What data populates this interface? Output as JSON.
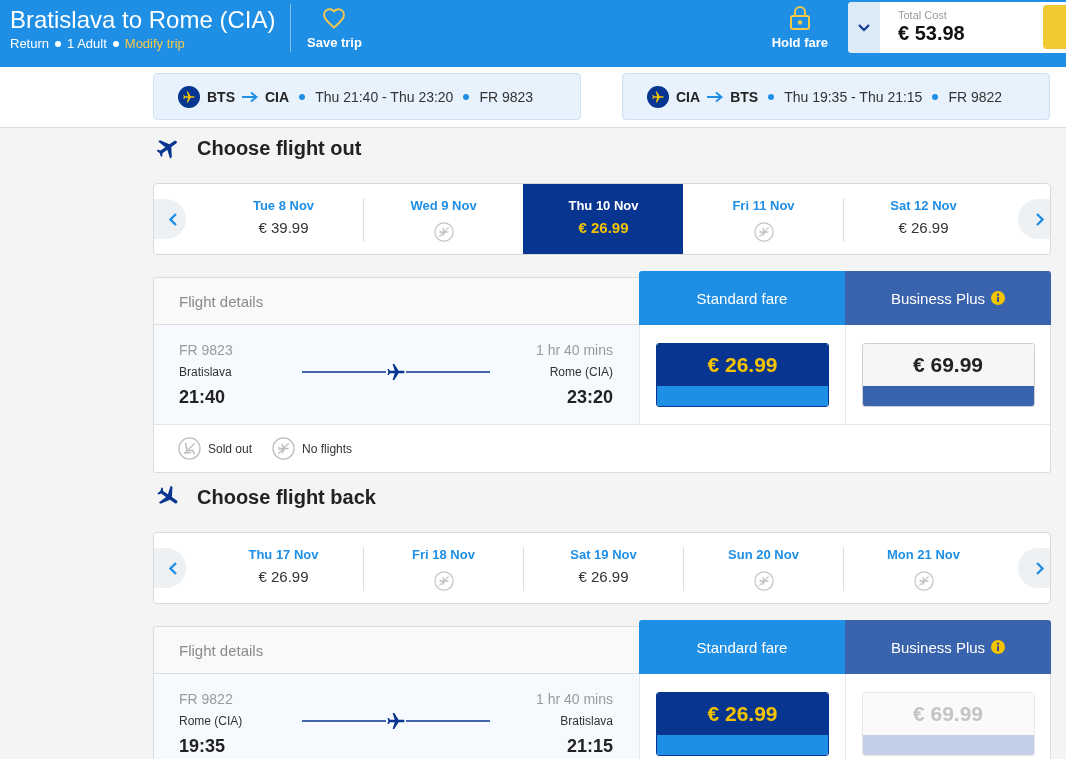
{
  "header": {
    "title": "Bratislava to Rome (CIA)",
    "trip_type": "Return",
    "passengers": "1 Adult",
    "modify_link": "Modify trip",
    "save_trip": "Save trip",
    "hold_fare": "Hold fare",
    "total_cost": {
      "label": "Total Cost",
      "amount": "€ 53.98"
    }
  },
  "journey_summary": [
    {
      "from": "BTS",
      "to": "CIA",
      "times": "Thu 21:40 - Thu 23:20",
      "flight": "FR 9823"
    },
    {
      "from": "CIA",
      "to": "BTS",
      "times": "Thu 19:35 - Thu 21:15",
      "flight": "FR 9822"
    }
  ],
  "sections": [
    {
      "kind": "outbound",
      "title": "Choose flight out",
      "dates": [
        {
          "day": "Tue 8 Nov",
          "kind": "price",
          "price": "€ 39.99",
          "selected": false
        },
        {
          "day": "Wed 9 Nov",
          "kind": "no_flights",
          "selected": false
        },
        {
          "day": "Thu 10 Nov",
          "kind": "price",
          "price": "€ 26.99",
          "selected": true
        },
        {
          "day": "Fri 11 Nov",
          "kind": "no_flights",
          "selected": false
        },
        {
          "day": "Sat 12 Nov",
          "kind": "price",
          "price": "€ 26.99",
          "selected": false
        }
      ],
      "fare_table": {
        "details_heading": "Flight details",
        "fares": [
          {
            "kind": "standard",
            "name": "Standard fare",
            "price": "€ 26.99",
            "selected": true,
            "disabled": false
          },
          {
            "kind": "business",
            "name": "Business Plus",
            "price": "€ 69.99",
            "selected": false,
            "disabled": false
          }
        ],
        "flight": {
          "number": "FR 9823",
          "duration": "1 hr 40 mins",
          "origin": "Bratislava",
          "destination": "Rome (CIA)",
          "depart": "21:40",
          "arrive": "23:20"
        },
        "legend": [
          {
            "kind": "sold_out",
            "label": "Sold out"
          },
          {
            "kind": "no_flights",
            "label": "No flights"
          }
        ]
      }
    },
    {
      "kind": "return",
      "title": "Choose flight back",
      "dates": [
        {
          "day": "Thu 17 Nov",
          "kind": "price",
          "price": "€ 26.99",
          "selected": false
        },
        {
          "day": "Fri 18 Nov",
          "kind": "no_flights",
          "selected": false
        },
        {
          "day": "Sat 19 Nov",
          "kind": "price",
          "price": "€ 26.99",
          "selected": false
        },
        {
          "day": "Sun 20 Nov",
          "kind": "no_flights",
          "selected": false
        },
        {
          "day": "Mon 21 Nov",
          "kind": "no_flights",
          "selected": false
        }
      ],
      "fare_table": {
        "details_heading": "Flight details",
        "fares": [
          {
            "kind": "standard",
            "name": "Standard fare",
            "price": "€ 26.99",
            "selected": true,
            "disabled": false
          },
          {
            "kind": "business",
            "name": "Business Plus",
            "price": "€ 69.99",
            "selected": false,
            "disabled": true
          }
        ],
        "flight": {
          "number": "FR 9822",
          "duration": "1 hr 40 mins",
          "origin": "Rome (CIA)",
          "destination": "Bratislava",
          "depart": "19:35",
          "arrive": "21:15"
        }
      }
    }
  ]
}
